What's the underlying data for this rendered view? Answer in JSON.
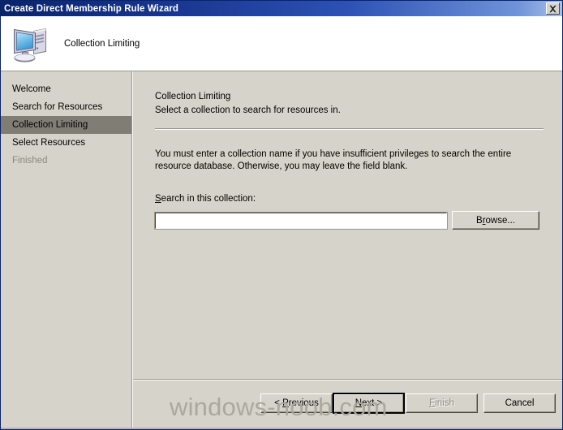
{
  "window": {
    "title": "Create Direct Membership Rule Wizard",
    "close_icon": "close-icon"
  },
  "header": {
    "icon": "computer-icon",
    "title": "Collection Limiting"
  },
  "sidebar": {
    "items": [
      {
        "label": "Welcome",
        "state": "normal"
      },
      {
        "label": "Search for Resources",
        "state": "normal"
      },
      {
        "label": "Collection Limiting",
        "state": "selected"
      },
      {
        "label": "Select Resources",
        "state": "normal"
      },
      {
        "label": "Finished",
        "state": "disabled"
      }
    ]
  },
  "main": {
    "heading": "Collection Limiting",
    "subheading": "Select a collection to search for resources in.",
    "paragraph": "You must enter a collection name if you have insufficient privileges to search the entire resource database. Otherwise, you may leave the field blank.",
    "field_label": "Search in this collection:",
    "field_label_accel": "S",
    "collection_value": "",
    "collection_placeholder": "",
    "browse_label": "Browse...",
    "browse_accel": "r"
  },
  "footer": {
    "previous_label": "< Previous",
    "previous_accel": "P",
    "next_label": "Next >",
    "next_accel": "N",
    "finish_label": "Finish",
    "finish_accel": "F",
    "cancel_label": "Cancel",
    "finish_enabled": false,
    "next_is_default": true
  },
  "watermark": {
    "text": "windows-noob.com"
  },
  "colors": {
    "titlebar_start": "#0a246a",
    "titlebar_end": "#a8bfe8",
    "dialog_face": "#d6d3ca",
    "selected_row": "#807d74",
    "disabled_text": "#8b887e",
    "border_shadow": "#9a9789",
    "field_white": "#ffffff",
    "watermark": "#a9a69c"
  }
}
